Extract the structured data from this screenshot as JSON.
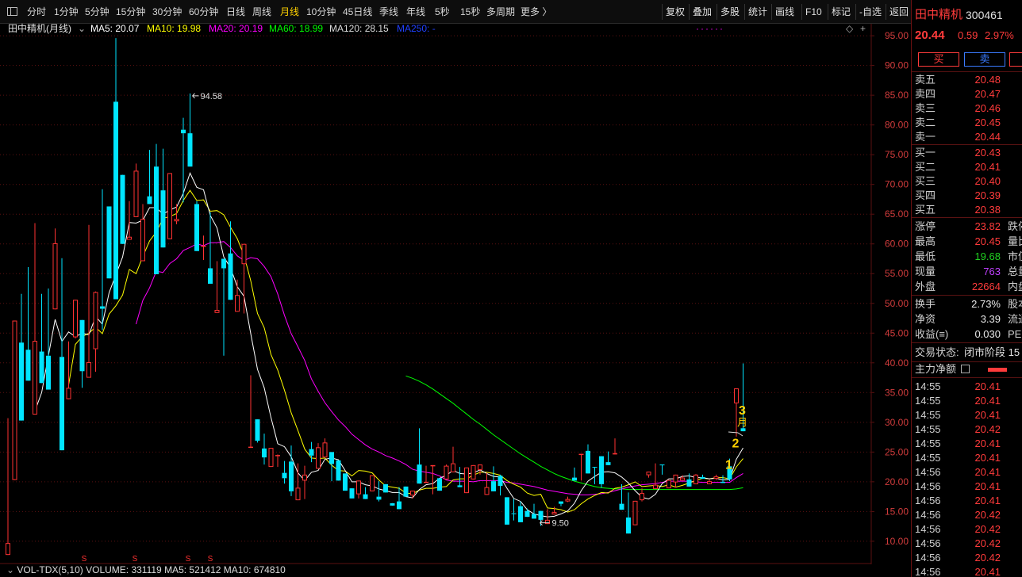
{
  "toolbar": {
    "periods": [
      {
        "label": "分时",
        "active": false
      },
      {
        "label": "1分钟",
        "active": false
      },
      {
        "label": "5分钟",
        "active": false
      },
      {
        "label": "15分钟",
        "active": false
      },
      {
        "label": "30分钟",
        "active": false
      },
      {
        "label": "60分钟",
        "active": false
      },
      {
        "label": "日线",
        "active": false
      },
      {
        "label": "周线",
        "active": false
      },
      {
        "label": "月线",
        "active": true
      },
      {
        "label": "10分钟",
        "active": false
      },
      {
        "label": "45日线",
        "active": false
      },
      {
        "label": "季线",
        "active": false
      },
      {
        "label": "年线",
        "active": false
      },
      {
        "label": "5秒",
        "active": false
      },
      {
        "label": "15秒",
        "active": false
      },
      {
        "label": "多周期",
        "active": false
      },
      {
        "label": "更多 〉",
        "active": false
      }
    ],
    "right_buttons": [
      "复权",
      "叠加",
      "多股",
      "统计",
      "画线",
      "F10",
      "标记",
      "-自选",
      "返回"
    ]
  },
  "chart_legend": {
    "title": "田中精机(月线)",
    "ma5": "MA5: 20.07",
    "ma10": "MA10: 19.98",
    "ma20": "MA20: 20.19",
    "ma60": "MA60: 18.99",
    "ma120": "MA120: 28.15",
    "ma250": "MA250: -"
  },
  "colors": {
    "up": "#ff3232",
    "down": "#00e5ff",
    "ma5": "#ffffff",
    "ma10": "#ffff00",
    "ma20": "#ff00ff",
    "ma60": "#00ff00",
    "grid": "#5a1010",
    "axis_text": "#d23c3c"
  },
  "chart_data": {
    "type": "candlestick",
    "y_axis_ticks": [
      "95.00",
      "90.00",
      "85.00",
      "80.00",
      "75.00",
      "70.00",
      "65.00",
      "60.00",
      "55.00",
      "50.00",
      "45.00",
      "40.00",
      "35.00",
      "30.00",
      "25.00",
      "20.00",
      "15.00",
      "10.00"
    ],
    "ylim": [
      10,
      95
    ],
    "max_label": "94.58",
    "min_label": "9.50",
    "candles": [
      [
        15.8,
        30.7,
        7.7,
        9.7
      ],
      [
        41.5,
        27.4,
        20.3,
        47.1
      ],
      [
        49.4,
        51.6,
        43.4,
        30.3
      ],
      [
        56.1,
        55.6,
        42.2,
        37.0
      ],
      [
        59.6,
        63.5,
        31.3,
        43.7
      ],
      [
        51.6,
        46.9,
        41.9,
        36.6
      ],
      [
        52.5,
        49.4,
        41.2,
        35.5
      ],
      [
        52.2,
        62.6,
        49.0,
        60.1
      ],
      [
        40.5,
        57.6,
        41.0,
        25.3
      ],
      [
        43.6,
        42.5,
        33.9,
        35.8
      ],
      [
        44.1,
        48.4,
        44.3,
        50.6
      ],
      [
        39.3,
        35.8,
        47.2,
        38.6
      ],
      [
        52.3,
        63.2,
        37.5,
        40.1
      ],
      [
        38.5,
        52.0,
        42.3,
        51.9
      ],
      [
        45.5,
        69.2,
        49.5,
        49.1
      ],
      [
        61.9,
        64.5,
        66.3,
        54.2
      ],
      [
        94.6,
        84.9,
        83.9,
        50.7
      ],
      [
        71.3,
        65.0,
        71.6,
        60.0
      ],
      [
        67.2,
        62.6,
        60.7,
        61.2
      ],
      [
        73.5,
        69.5,
        64.5,
        72.3
      ],
      [
        66.7,
        65.1,
        57.1,
        64.2
      ],
      [
        75.8,
        69.2,
        68.0,
        66.7
      ],
      [
        70.3,
        76.8,
        73.0,
        54.9
      ],
      [
        76.0,
        67.3,
        69.0,
        59.4
      ],
      [
        67.2,
        63.4,
        60.8,
        71.9
      ],
      [
        66.7,
        63.3,
        63.8,
        64.2
      ],
      [
        67.0,
        81.2,
        79.2,
        78.6
      ],
      [
        79.3,
        85.3,
        78.6,
        73.0
      ],
      [
        67.2,
        62.0,
        66.7,
        58.8
      ],
      [
        61.4,
        57.3,
        59.6,
        59.7
      ],
      [
        64.3,
        65.3,
        55.9,
        53.3
      ],
      [
        57.1,
        50.7,
        48.4,
        48.9
      ],
      [
        41.2,
        56.3,
        57.5,
        55.9
      ],
      [
        63.8,
        59.9,
        58.4,
        50.6
      ],
      [
        54.0,
        53.3,
        48.6,
        51.4
      ],
      [
        52.2,
        48.3,
        56.6,
        60.0
      ],
      [
        28.0,
        37.9,
        25.7,
        25.9
      ],
      [
        26.6,
        27.0,
        30.5,
        26.9
      ],
      [
        28.1,
        22.9,
        25.6,
        24.1
      ],
      [
        25.7,
        24.8,
        22.5,
        25.7
      ],
      [
        22.5,
        24.6,
        24.3,
        24.5
      ],
      [
        19.7,
        23.5,
        21.5,
        20.6
      ],
      [
        17.6,
        26.1,
        23.4,
        18.4
      ],
      [
        21.0,
        23.1,
        16.9,
        19.0
      ],
      [
        17.1,
        22.7,
        20.2,
        21.2
      ],
      [
        23.3,
        26.7,
        25.5,
        24.4
      ],
      [
        26.5,
        25.9,
        22.2,
        25.8
      ],
      [
        27.1,
        27.3,
        24.1,
        26.6
      ],
      [
        23.7,
        20.1,
        25.0,
        23.0
      ],
      [
        23.6,
        21.3,
        23.6,
        20.2
      ],
      [
        21.3,
        20.1,
        21.4,
        18.5
      ],
      [
        17.9,
        17.8,
        18.9,
        17.2
      ],
      [
        17.2,
        20.0,
        17.9,
        20.2
      ],
      [
        17.9,
        19.1,
        17.9,
        17.1
      ],
      [
        19.5,
        20.1,
        18.4,
        21.1
      ],
      [
        16.7,
        20.1,
        17.5,
        17.0
      ],
      [
        19.2,
        18.8,
        19.6,
        18.2
      ],
      [
        16.3,
        16.0,
        16.4,
        16.0
      ],
      [
        19.1,
        19.1,
        16.7,
        15.4
      ],
      [
        17.6,
        17.5,
        19.2,
        17.5
      ],
      [
        17.2,
        18.2,
        17.7,
        18.5
      ],
      [
        29.0,
        24.6,
        22.9,
        19.7
      ],
      [
        19.8,
        22.7,
        20.0,
        20.0
      ],
      [
        17.9,
        19.8,
        22.6,
        22.8
      ],
      [
        19.0,
        19.3,
        20.6,
        18.5
      ],
      [
        22.9,
        22.2,
        20.4,
        22.7
      ],
      [
        21.8,
        25.9,
        21.6,
        23.1
      ],
      [
        22.5,
        21.0,
        19.4,
        19.1
      ],
      [
        21.7,
        18.8,
        18.1,
        22.4
      ],
      [
        22.1,
        22.6,
        20.4,
        22.8
      ],
      [
        21.2,
        22.7,
        22.0,
        22.9
      ],
      [
        21.4,
        21.5,
        17.8,
        19.1
      ],
      [
        22.3,
        22.6,
        20.1,
        18.4
      ],
      [
        21.2,
        17.7,
        21.0,
        19.3
      ],
      [
        16.8,
        17.0,
        17.4,
        12.8
      ],
      [
        13.5,
        17.1,
        14.7,
        14.6
      ],
      [
        16.7,
        16.6,
        15.9,
        13.2
      ],
      [
        15.5,
        14.2,
        15.1,
        14.1
      ],
      [
        15.7,
        16.3,
        14.6,
        13.8
      ],
      [
        13.1,
        12.6,
        15.1,
        13.6
      ],
      [
        15.2,
        15.4,
        12.9,
        13.6
      ],
      [
        15.8,
        14.8,
        14.5,
        14.9
      ],
      [
        16.3,
        15.9,
        16.7,
        16.3
      ],
      [
        17.5,
        16.6,
        16.7,
        17.1
      ],
      [
        22.4,
        21.7,
        20.7,
        20.2
      ],
      [
        22.2,
        20.2,
        24.7,
        24.7
      ],
      [
        26.3,
        25.4,
        25.2,
        21.4
      ],
      [
        19.6,
        20.2,
        22.5,
        22.4
      ],
      [
        20.3,
        19.0,
        24.3,
        19.6
      ],
      [
        25.1,
        23.6,
        23.3,
        22.8
      ],
      [
        27.3,
        25.1,
        24.6,
        24.8
      ],
      [
        18.0,
        19.6,
        16.3,
        15.3
      ],
      [
        16.3,
        18.2,
        14.0,
        11.3
      ],
      [
        13.3,
        15.5,
        12.7,
        16.8
      ],
      [
        16.7,
        18.9,
        16.9,
        18.1
      ],
      [
        20.7,
        21.0,
        21.1,
        21.7
      ],
      [
        20.5,
        23.1,
        18.8,
        19.5
      ],
      [
        21.2,
        22.2,
        22.9,
        22.8
      ],
      [
        19.3,
        19.6,
        18.9,
        20.3
      ],
      [
        20.0,
        19.0,
        19.9,
        21.2
      ],
      [
        21.1,
        20.4,
        20.2,
        20.7
      ],
      [
        21.4,
        20.1,
        20.4,
        19.2
      ],
      [
        21.3,
        21.0,
        19.6,
        21.2
      ],
      [
        21.2,
        20.8,
        20.8,
        20.5
      ],
      [
        20.4,
        20.2,
        19.6,
        20.1
      ],
      [
        21.2,
        20.3,
        20.5,
        20.9
      ],
      [
        21.1,
        20.3,
        20.0,
        19.8
      ],
      [
        20.1,
        23.9,
        22.6,
        20.4
      ],
      [
        27.6,
        29.0,
        33.2,
        35.7
      ],
      [
        39.9,
        30.8,
        29.0,
        28.5
      ]
    ],
    "ma5": [
      null,
      null,
      null,
      null,
      31.9,
      35.0,
      41.2,
      47.3,
      43.6,
      45.2,
      44.4,
      45.0,
      44.7,
      47.8,
      46.5,
      51.8,
      54.8,
      57.8,
      63.6,
      63.5,
      64.0,
      66.1,
      66.1,
      65.0,
      65.7,
      66.2,
      68.5,
      71.9,
      69.5,
      69.1,
      64.8,
      62.7,
      57.8,
      56.0,
      52.8,
      51.2,
      44.9,
      38.9,
      35.8,
      30.8,
      26.4,
      25.9,
      24.2,
      21.5,
      20.2,
      21.6,
      21.9,
      23.8,
      24.0,
      23.7,
      21.9,
      20.0,
      20.0,
      19.5,
      19.3,
      18.8,
      18.5,
      18.2,
      18.2,
      17.5,
      17.3,
      18.7,
      19.5,
      19.7,
      20.6,
      21.1,
      21.9,
      21.4,
      21.3,
      21.5,
      22.0,
      21.4,
      20.9,
      20.8,
      18.9,
      17.2,
      16.7,
      15.3,
      14.6,
      14.3,
      14.1,
      14.2,
      14.6,
      15.1,
      16.4,
      18.5,
      20.1,
      20.9,
      21.6,
      21.7,
      21.5,
      20.8,
      19.8,
      18.5,
      17.4,
      17.1,
      17.9,
      19.7,
      20.5,
      20.5,
      20.9,
      21.0,
      20.7,
      20.7,
      20.5,
      20.6,
      20.3,
      20.4,
      23.8,
      25.7
    ],
    "ma10": [
      null,
      null,
      null,
      null,
      null,
      null,
      null,
      null,
      null,
      36.3,
      43.1,
      44.4,
      45.0,
      46.0,
      44.9,
      48.2,
      49.6,
      51.4,
      55.7,
      55.0,
      57.9,
      60.5,
      62.0,
      64.3,
      64.6,
      65.1,
      67.3,
      69.0,
      67.3,
      67.4,
      65.5,
      65.6,
      64.9,
      62.8,
      60.9,
      58.1,
      53.8,
      48.3,
      45.9,
      41.4,
      38.8,
      35.4,
      31.6,
      28.6,
      25.5,
      24.0,
      23.9,
      24.0,
      22.8,
      21.9,
      21.8,
      21.0,
      21.9,
      21.8,
      21.5,
      20.3,
      19.3,
      19.1,
      18.9,
      18.1,
      18.0,
      18.6,
      18.9,
      18.9,
      19.1,
      19.2,
      20.3,
      20.5,
      20.5,
      21.1,
      21.6,
      21.6,
      21.4,
      21.1,
      20.2,
      19.6,
      19.1,
      18.1,
      17.7,
      17.9,
      15.6,
      15.5,
      15.3,
      14.9,
      15.3,
      16.3,
      17.1,
      17.7,
      18.2,
      18.1,
      18.9,
      19.1,
      19.5,
      20.0,
      19.2,
      19.3,
      19.4,
      19.2,
      19.5,
      19.1,
      19.4,
      19.8,
      20.2,
      20.6,
      20.5,
      20.7,
      20.7,
      20.5,
      22.5,
      23.9
    ],
    "ma20": [
      null,
      null,
      null,
      null,
      null,
      null,
      null,
      null,
      null,
      null,
      null,
      null,
      null,
      null,
      null,
      null,
      null,
      null,
      null,
      46.5,
      50.5,
      52.6,
      55.4,
      55.2,
      56.7,
      57.5,
      58.9,
      59.4,
      60.0,
      59.7,
      60.2,
      60.2,
      60.4,
      59.4,
      58.0,
      57.2,
      57.7,
      57.5,
      56.2,
      54.5,
      51.6,
      48.0,
      44.9,
      42.7,
      40.4,
      37.3,
      35.2,
      33.3,
      31.8,
      30.4,
      29.3,
      28.0,
      27.1,
      26.2,
      25.5,
      25.0,
      24.4,
      24.0,
      23.5,
      22.9,
      22.1,
      21.8,
      21.6,
      21.4,
      21.0,
      20.3,
      20.1,
      20.1,
      20.1,
      20.0,
      20.2,
      20.2,
      20.2,
      20.2,
      19.9,
      19.8,
      19.6,
      19.4,
      19.2,
      18.9,
      18.6,
      18.4,
      18.2,
      18.0,
      17.9,
      17.8,
      17.8,
      17.9,
      18.0,
      18.2,
      18.5,
      18.8,
      19.1,
      19.3,
      19.5,
      19.6,
      19.7,
      19.9,
      20.1,
      20.1,
      20.1,
      20.1,
      20.0,
      19.9,
      19.9,
      19.9,
      19.9,
      19.9,
      20.7,
      21.4
    ],
    "ma60": [
      null,
      null,
      null,
      null,
      null,
      null,
      null,
      null,
      null,
      null,
      null,
      null,
      null,
      null,
      null,
      null,
      null,
      null,
      null,
      null,
      null,
      null,
      null,
      null,
      null,
      null,
      null,
      null,
      null,
      null,
      null,
      null,
      null,
      null,
      null,
      null,
      null,
      null,
      null,
      null,
      null,
      null,
      null,
      null,
      null,
      null,
      null,
      null,
      null,
      null,
      null,
      null,
      null,
      null,
      null,
      null,
      null,
      null,
      null,
      37.8,
      37.4,
      36.9,
      36.3,
      35.6,
      34.8,
      34.0,
      33.2,
      32.3,
      31.4,
      30.5,
      29.7,
      28.8,
      27.9,
      27.1,
      26.3,
      25.5,
      24.7,
      24.0,
      23.3,
      22.6,
      22.0,
      21.4,
      20.9,
      20.5,
      20.1,
      19.8,
      19.5,
      19.2,
      19.0,
      18.9,
      18.8,
      18.8,
      18.7,
      18.7,
      18.7,
      18.7,
      18.7,
      18.7,
      18.7,
      18.7,
      18.7,
      18.7,
      18.7,
      18.7,
      18.7,
      18.7,
      18.7,
      18.7,
      18.8,
      19.0
    ],
    "annotations": [
      "1",
      "2",
      "3",
      "月"
    ],
    "s_markers": [
      "S",
      "S",
      "S",
      "S"
    ]
  },
  "volume_legend": {
    "name": "VOL-TDX(5,10)",
    "volume": "VOLUME: 331119",
    "ma5": "MA5: 521412",
    "ma10": "MA10: 674810"
  },
  "panel": {
    "stock_name": "田中精机",
    "stock_code": "300461",
    "price": "20.44",
    "change": "0.59",
    "change_pct": "2.97%",
    "buy_label": "买",
    "sell_label": "卖",
    "asks": [
      {
        "label": "卖五",
        "price": "20.48"
      },
      {
        "label": "卖四",
        "price": "20.47"
      },
      {
        "label": "卖三",
        "price": "20.46"
      },
      {
        "label": "卖二",
        "price": "20.45"
      },
      {
        "label": "卖一",
        "price": "20.44"
      }
    ],
    "bids": [
      {
        "label": "买一",
        "price": "20.43"
      },
      {
        "label": "买二",
        "price": "20.41"
      },
      {
        "label": "买三",
        "price": "20.40"
      },
      {
        "label": "买四",
        "price": "20.39"
      },
      {
        "label": "买五",
        "price": "20.38"
      }
    ],
    "stats": [
      {
        "label": "涨停",
        "value": "23.82",
        "color": "red",
        "ext": "跌停"
      },
      {
        "label": "最高",
        "value": "20.45",
        "color": "red",
        "ext": "量比"
      },
      {
        "label": "最低",
        "value": "19.68",
        "color": "green",
        "ext": "市值"
      },
      {
        "label": "现量",
        "value": "763",
        "color": "purple",
        "ext": "总量"
      },
      {
        "label": "外盘",
        "value": "22664",
        "color": "red",
        "ext": "内盘"
      }
    ],
    "stats2": [
      {
        "label": "换手",
        "value": "2.73%",
        "ext": "股本"
      },
      {
        "label": "净资",
        "value": "3.39",
        "ext": "流通"
      },
      {
        "label": "收益(≡)",
        "value": "0.030",
        "ext": "PE"
      }
    ],
    "trade_status_label": "交易状态: ",
    "trade_status_value": "闭市阶段 15",
    "fund_flow_label": "主力净额",
    "ticks": [
      {
        "time": "14:55",
        "price": "20.41"
      },
      {
        "time": "14:55",
        "price": "20.41"
      },
      {
        "time": "14:55",
        "price": "20.41"
      },
      {
        "time": "14:55",
        "price": "20.42"
      },
      {
        "time": "14:55",
        "price": "20.41"
      },
      {
        "time": "14:55",
        "price": "20.41"
      },
      {
        "time": "14:56",
        "price": "20.41"
      },
      {
        "time": "14:56",
        "price": "20.41"
      },
      {
        "time": "14:56",
        "price": "20.41"
      },
      {
        "time": "14:56",
        "price": "20.42"
      },
      {
        "time": "14:56",
        "price": "20.42"
      },
      {
        "time": "14:56",
        "price": "20.42"
      },
      {
        "time": "14:56",
        "price": "20.42"
      },
      {
        "time": "14:56",
        "price": "20.41"
      }
    ]
  }
}
